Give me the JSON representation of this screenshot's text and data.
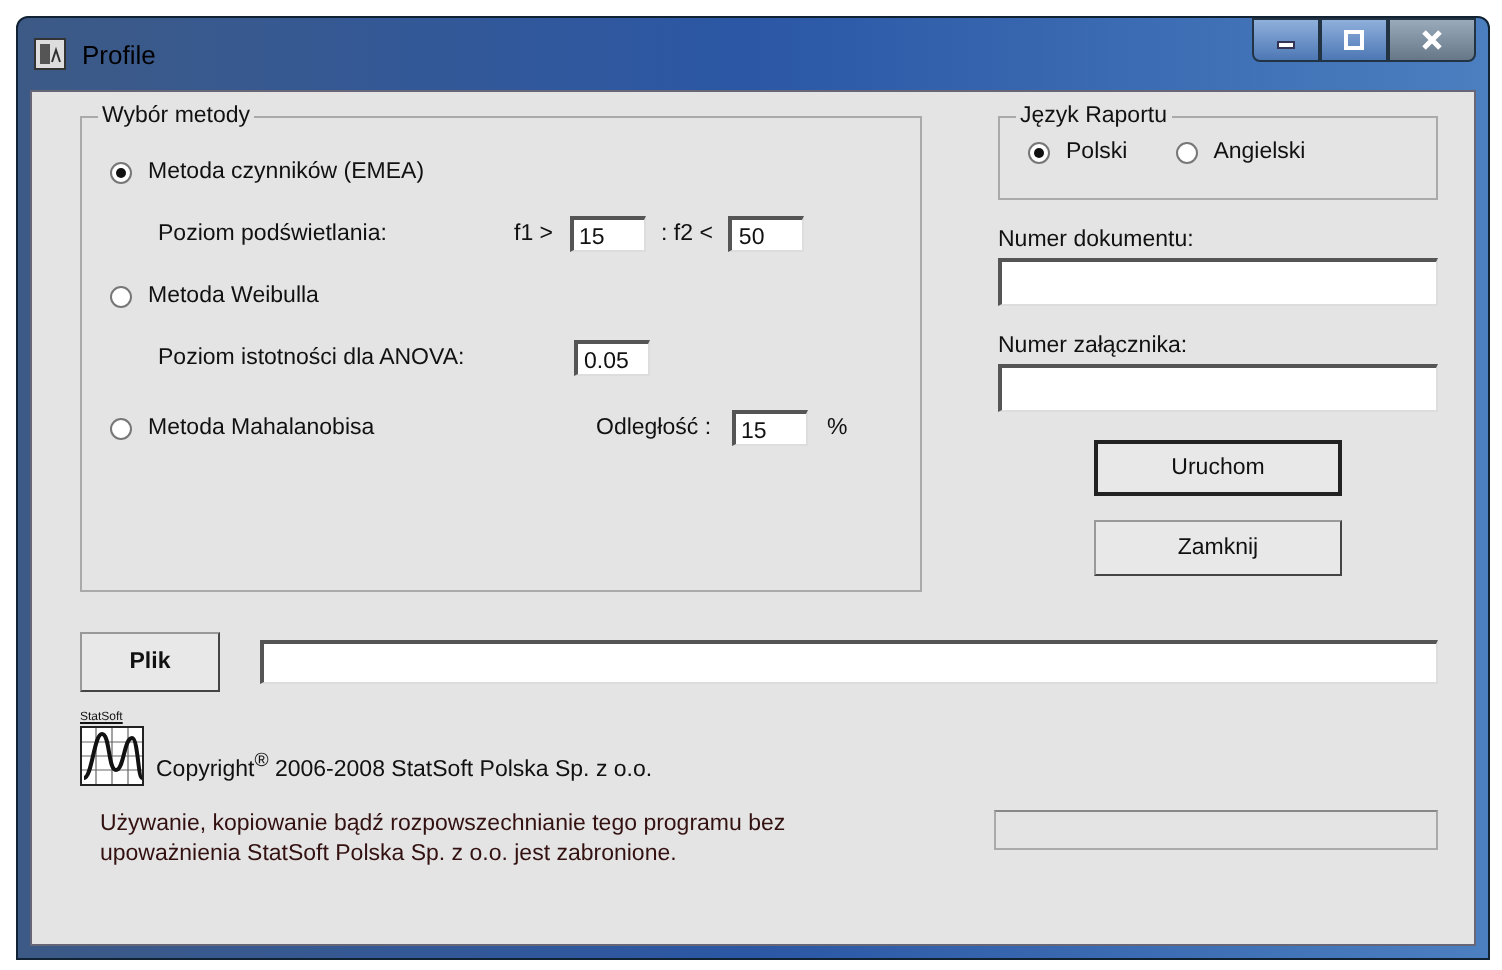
{
  "window": {
    "title": "Profile"
  },
  "method_group": {
    "title": "Wybór metody",
    "options": [
      {
        "kind": "factors",
        "label": "Metoda czynników  (EMEA)",
        "selected": true,
        "sub_label": "Poziom podświetlania:",
        "f1_label": "f1 >",
        "f1_value": "15",
        "f2_label": ": f2 <",
        "f2_value": "50"
      },
      {
        "kind": "weibull",
        "label": "Metoda Weibulla",
        "selected": false,
        "sub_label": "Poziom istotności dla ANOVA:",
        "value": "0.05"
      },
      {
        "kind": "mahalanobis",
        "label": "Metoda Mahalanobisa",
        "selected": false,
        "distance_label": "Odległość :",
        "value": "15",
        "unit": "%"
      }
    ]
  },
  "language_group": {
    "title": "Język Raportu",
    "options": [
      {
        "label": "Polski",
        "selected": true
      },
      {
        "label": "Angielski",
        "selected": false
      }
    ]
  },
  "document_number": {
    "label": "Numer dokumentu:"
  },
  "attachment_number": {
    "label": "Numer załącznika:"
  },
  "buttons": [
    {
      "label": "Uruchom",
      "default": true
    },
    {
      "label": "Zamknij",
      "default": false
    }
  ],
  "file": {
    "button": "Plik"
  },
  "progress": {
    "level": 0
  },
  "logo_text": "StatSoft",
  "copyright": "Copyright$^{®}$  2006-2008 StatSoft Polska Sp. z o.o.",
  "notice": "Używanie, kopiowanie bądź rozpowszechnianie tego programu bez upoważnienia StatSoft Polska Sp. z o.o. jest zabronione."
}
